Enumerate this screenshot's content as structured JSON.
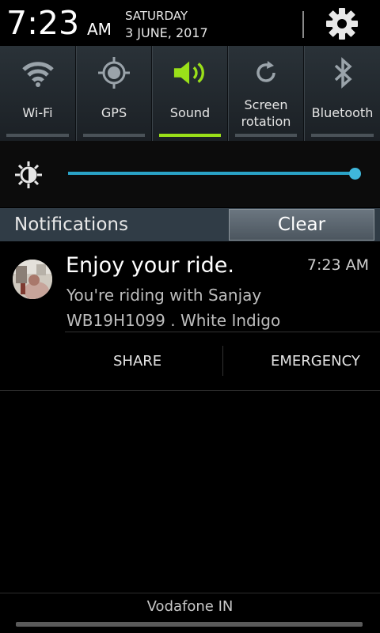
{
  "header": {
    "time": "7:23",
    "ampm": "AM",
    "day": "SATURDAY",
    "date": "3 JUNE, 2017"
  },
  "toggles": [
    {
      "label": "Wi-Fi",
      "icon": "wifi-icon",
      "on": false
    },
    {
      "label": "GPS",
      "icon": "gps-icon",
      "on": false
    },
    {
      "label": "Sound",
      "icon": "sound-icon",
      "on": true
    },
    {
      "label_line1": "Screen",
      "label_line2": "rotation",
      "icon": "rotation-icon",
      "on": false
    },
    {
      "label": "Bluetooth",
      "icon": "bluetooth-icon",
      "on": false
    }
  ],
  "brightness": {
    "level": 1.0,
    "icon": "brightness-icon"
  },
  "notifications_bar": {
    "title": "Notifications",
    "clear_label": "Clear"
  },
  "notification": {
    "title": "Enjoy your ride.",
    "time": "7:23 AM",
    "line1": "You're riding with Sanjay",
    "line2": "WB19H1099 . White Indigo",
    "actions": {
      "share": "SHARE",
      "emergency": "EMERGENCY"
    }
  },
  "carrier": "Vodafone IN",
  "colors": {
    "accent_on": "#9ae019",
    "slider": "#2aa3c7",
    "panel": "#2a3238"
  }
}
